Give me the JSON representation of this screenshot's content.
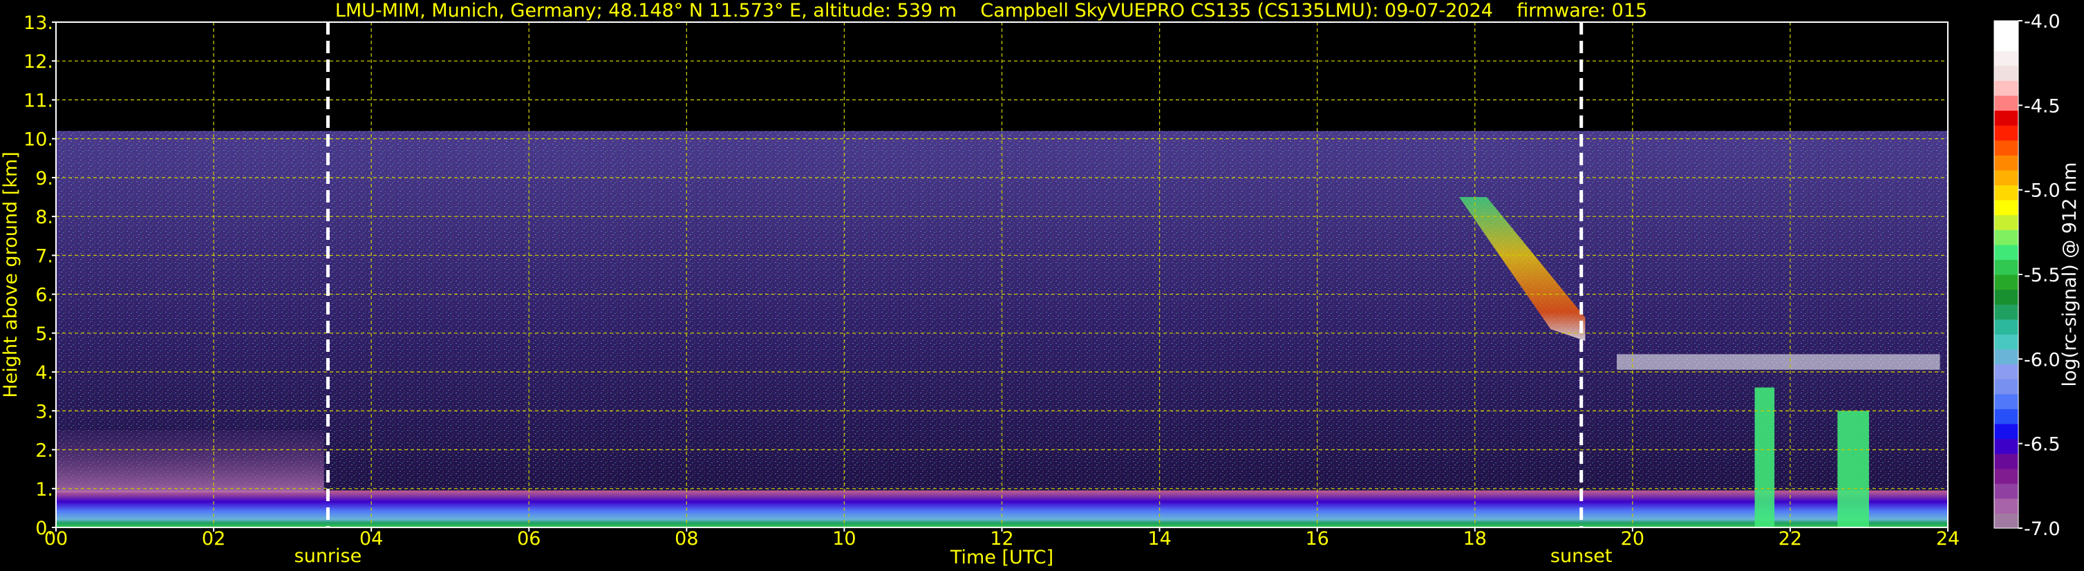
{
  "title": "LMU-MIM, Munich, Germany; 48.148° N 11.573° E, altitude: 539 m    Campbell SkyVUEPRO CS135 (CS135LMU): 09-07-2024    firmware: 015",
  "colors": {
    "text": "#ffff00",
    "grid": "#c8c800",
    "background": "#000000",
    "marker_line": "#ffffff"
  },
  "chart_data": {
    "type": "heatmap",
    "xlabel": "Time [UTC]",
    "ylabel": "Height above ground [km]",
    "xlim": [
      0,
      24
    ],
    "ylim": [
      0,
      13
    ],
    "xticks": [
      {
        "value": 0,
        "label": "00"
      },
      {
        "value": 2,
        "label": "02"
      },
      {
        "value": 4,
        "label": "04"
      },
      {
        "value": 6,
        "label": "06"
      },
      {
        "value": 8,
        "label": "08"
      },
      {
        "value": 10,
        "label": "10"
      },
      {
        "value": 12,
        "label": "12"
      },
      {
        "value": 14,
        "label": "14"
      },
      {
        "value": 16,
        "label": "16"
      },
      {
        "value": 18,
        "label": "18"
      },
      {
        "value": 20,
        "label": "20"
      },
      {
        "value": 22,
        "label": "22"
      },
      {
        "value": 24,
        "label": "24"
      }
    ],
    "yticks": [
      {
        "value": 0,
        "label": "0."
      },
      {
        "value": 1,
        "label": "1."
      },
      {
        "value": 2,
        "label": "2."
      },
      {
        "value": 3,
        "label": "3."
      },
      {
        "value": 4,
        "label": "4."
      },
      {
        "value": 5,
        "label": "5."
      },
      {
        "value": 6,
        "label": "6."
      },
      {
        "value": 7,
        "label": "7."
      },
      {
        "value": 8,
        "label": "8."
      },
      {
        "value": 9,
        "label": "9."
      },
      {
        "value": 10,
        "label": "10."
      },
      {
        "value": 11,
        "label": "11."
      },
      {
        "value": 12,
        "label": "12."
      },
      {
        "value": 13,
        "label": "13."
      }
    ],
    "grid": true,
    "markers": [
      {
        "label": "sunrise",
        "time": 3.45
      },
      {
        "label": "sunset",
        "time": 19.35
      }
    ],
    "data_top_km": 10.2,
    "colorbar": {
      "label": "log(rc-signal) @ 912 nm",
      "range": [
        -7.0,
        -4.0
      ],
      "ticks": [
        {
          "value": -4.0,
          "label": "-4.0"
        },
        {
          "value": -4.5,
          "label": "-4.5"
        },
        {
          "value": -5.0,
          "label": "-5.0"
        },
        {
          "value": -5.5,
          "label": "-5.5"
        },
        {
          "value": -6.0,
          "label": "-6.0"
        },
        {
          "value": -6.5,
          "label": "-6.5"
        },
        {
          "value": -7.0,
          "label": "-7.0"
        }
      ],
      "colors": [
        "#a07aa0",
        "#a864a8",
        "#9040a0",
        "#801c90",
        "#6a0a98",
        "#3c00c8",
        "#1410f0",
        "#2850f8",
        "#5078f8",
        "#7890f0",
        "#8c9cf0",
        "#6ab4d8",
        "#48c8c0",
        "#2cb89c",
        "#20a060",
        "#189030",
        "#28a828",
        "#30c850",
        "#40e878",
        "#80f060",
        "#c8f030",
        "#ffff00",
        "#ffd800",
        "#ffb000",
        "#ff8800",
        "#ff5800",
        "#ff2000",
        "#e00000",
        "#ff8080",
        "#ffc0c0",
        "#f0e0e0",
        "#f8f0f0",
        "#ffffff",
        "#ffffff"
      ]
    },
    "features": [
      {
        "name": "boundary layer",
        "t": [
          0,
          24
        ],
        "h": [
          0,
          0.95
        ]
      },
      {
        "name": "residual layer",
        "t": [
          0,
          3.4
        ],
        "h": [
          0.9,
          2.5
        ]
      },
      {
        "name": "cloud layer (sunset side)",
        "t": [
          19.8,
          23.9
        ],
        "h": [
          3.0,
          4.6
        ]
      },
      {
        "name": "descending cloud streak",
        "t": [
          17.8,
          19.4
        ],
        "h": [
          4.8,
          8.5
        ]
      },
      {
        "name": "precipitation column",
        "t": [
          21.55,
          21.8
        ],
        "h": [
          0,
          3.6
        ]
      },
      {
        "name": "precipitation column",
        "t": [
          22.6,
          23.0
        ],
        "h": [
          0,
          3.0
        ]
      }
    ]
  }
}
